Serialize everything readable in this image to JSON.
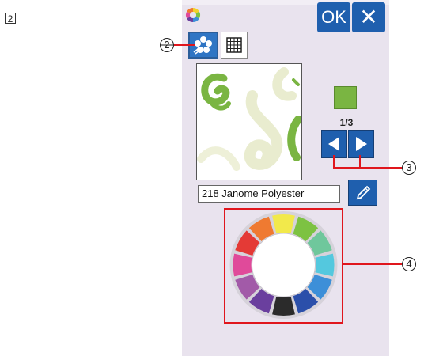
{
  "step": {
    "number": "2"
  },
  "toolbar": {
    "ok_label": "OK",
    "close_label": "✕"
  },
  "mode_buttons": [
    {
      "name": "color-select",
      "icon": "flower-icon",
      "selected": true
    },
    {
      "name": "grid-view",
      "icon": "grid-icon",
      "selected": false
    }
  ],
  "thread_color": {
    "swatch_hex": "#7ab542",
    "counter": "1/3"
  },
  "thread": {
    "name": "218 Janome Polyester"
  },
  "color_wheel": {
    "segments": [
      "#f2e94b",
      "#7dc242",
      "#6fc79c",
      "#54c8de",
      "#3d8fd8",
      "#2b4faa",
      "#2b2b2b",
      "#6a3f9e",
      "#a25aa8",
      "#e04a9a",
      "#e43a36",
      "#ef7a31"
    ]
  },
  "callouts": [
    "2",
    "3",
    "4"
  ]
}
